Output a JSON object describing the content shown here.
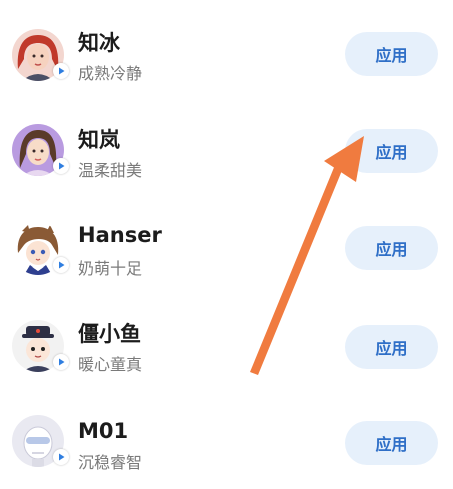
{
  "voices": [
    {
      "name": "知冰",
      "desc": "成熟冷静",
      "button": "应用",
      "avatar_icon": "woman-red-hair-avatar",
      "accent": "#d9534f"
    },
    {
      "name": "知岚",
      "desc": "温柔甜美",
      "button": "应用",
      "avatar_icon": "woman-purple-avatar",
      "accent": "#8e6ad1"
    },
    {
      "name": "Hanser",
      "desc": "奶萌十足",
      "button": "应用",
      "avatar_icon": "anime-girl-avatar",
      "accent": "#8a5a35"
    },
    {
      "name": "僵小鱼",
      "desc": "暖心童真",
      "button": "应用",
      "avatar_icon": "jiangshi-boy-avatar",
      "accent": "#3a3f5c"
    },
    {
      "name": "M01",
      "desc": "沉稳睿智",
      "button": "应用",
      "avatar_icon": "robot-head-avatar",
      "accent": "#c9c9d8"
    }
  ],
  "colors": {
    "button_bg": "#e6f0fb",
    "button_text": "#2f6fc7",
    "play_icon": "#2f7ee0",
    "annotation_arrow": "#f07b3f"
  }
}
